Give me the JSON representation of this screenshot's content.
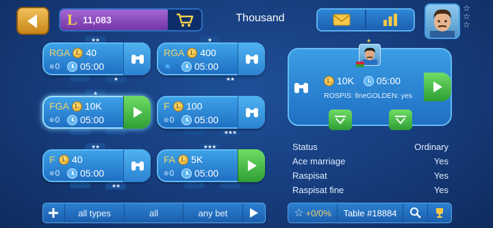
{
  "header": {
    "coins": "11,083",
    "coin_symbol": "L",
    "title": "Thousand"
  },
  "tables": [
    {
      "type": "RGA",
      "bet": "40",
      "players": "0",
      "time": "05:00",
      "action": "binoculars-icon",
      "stars_top": "★★",
      "stars_bottom": "★"
    },
    {
      "type": "RGA",
      "bet": "400",
      "players": "",
      "time": "05:00",
      "action": "binoculars-icon",
      "stars_top": "★",
      "stars_bottom": "★★"
    },
    {
      "type": "FGA",
      "bet": "10K",
      "players": "0",
      "time": "05:00",
      "action": "play-icon",
      "stars_top": "★",
      "stars_bottom": ""
    },
    {
      "type": "F",
      "bet": "100",
      "players": "0",
      "time": "05:00",
      "action": "binoculars-icon",
      "stars_top": "",
      "stars_bottom": "★★★"
    },
    {
      "type": "F",
      "bet": "40",
      "players": "0",
      "time": "05:00",
      "action": "binoculars-icon",
      "stars_top": "★★",
      "stars_bottom": "★★"
    },
    {
      "type": "FA",
      "bet": "5K",
      "players": "0",
      "time": "05:00",
      "action": "play-icon",
      "stars_top": "★★★",
      "stars_bottom": ""
    }
  ],
  "filters": {
    "types": "all types",
    "all": "all",
    "bet": "any bet"
  },
  "selected_table": {
    "bet": "10K",
    "time": "05:00",
    "rules": "ROSPIS: fineGOLDEN: yes"
  },
  "details": [
    {
      "label": "Status",
      "value": "Ordinary"
    },
    {
      "label": "Ace marriage",
      "value": "Yes"
    },
    {
      "label": "Raspisat",
      "value": "Yes"
    },
    {
      "label": "Raspisat fine",
      "value": "Yes"
    }
  ],
  "bottom": {
    "rating": "+0/0%",
    "table_number": "Table #18884"
  },
  "colors": {
    "background": "#163c7c",
    "card": "#2b82d2",
    "play": "#3fae3f",
    "coin": "#f7d24a"
  }
}
